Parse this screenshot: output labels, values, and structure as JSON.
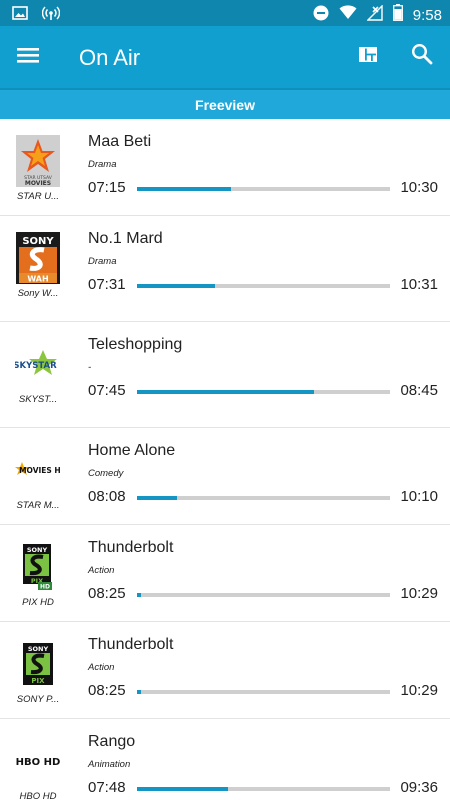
{
  "status_bar": {
    "time": "9:58",
    "icons": [
      "image-icon",
      "hotspot-icon",
      "do-not-disturb-icon",
      "wifi-icon",
      "no-signal-icon",
      "battery-icon"
    ]
  },
  "app_bar": {
    "title": "On Air",
    "icons": [
      "menu-icon",
      "layout-grid-icon",
      "search-icon"
    ]
  },
  "sub_bar": {
    "title": "Freeview"
  },
  "colors": {
    "status_bar": "#0f86ad",
    "app_bar": "#119fcf",
    "sub_bar": "#21a8da",
    "progress": "#1495c4",
    "track": "#cfcfcf"
  },
  "programs": [
    {
      "channel": "STAR U...",
      "logo_icon": "star-utsav-movies-logo-icon",
      "title": "Maa Beti",
      "genre": "Drama",
      "start": "07:15",
      "end": "10:30",
      "progress": 0.37
    },
    {
      "channel": "Sony W...",
      "logo_icon": "sony-wah-logo-icon",
      "title": "No.1 Mard",
      "genre": "Drama",
      "start": "07:31",
      "end": "10:31",
      "progress": 0.31
    },
    {
      "channel": "SKYST...",
      "logo_icon": "skystar-logo-icon",
      "title": "Teleshopping",
      "genre": "-",
      "start": "07:45",
      "end": "08:45",
      "progress": 0.7
    },
    {
      "channel": "STAR M...",
      "logo_icon": "star-movies-hd-logo-icon",
      "title": "Home Alone",
      "genre": "Comedy",
      "start": "08:08",
      "end": "10:10",
      "progress": 0.16
    },
    {
      "channel": "PIX HD",
      "logo_icon": "sony-pix-hd-logo-icon",
      "title": "Thunderbolt",
      "genre": "Action",
      "start": "08:25",
      "end": "10:29",
      "progress": 0.015
    },
    {
      "channel": "SONY P...",
      "logo_icon": "sony-pix-logo-icon",
      "title": "Thunderbolt",
      "genre": "Action",
      "start": "08:25",
      "end": "10:29",
      "progress": 0.015
    },
    {
      "channel": "HBO HD",
      "logo_icon": "hbo-hd-logo-icon",
      "title": "Rango",
      "genre": "Animation",
      "start": "07:48",
      "end": "09:36",
      "progress": 0.36
    }
  ],
  "logo_text": {
    "sony": "SONY",
    "wah": "WAH",
    "skystar": "SKYSTAR",
    "movies_hd": "MOVIES HD",
    "pix": "PIX",
    "hd": "HD",
    "hbo_hd": "HBO HD",
    "star_utsav": "STAR UTSAV",
    "movies": "MOVIES"
  }
}
